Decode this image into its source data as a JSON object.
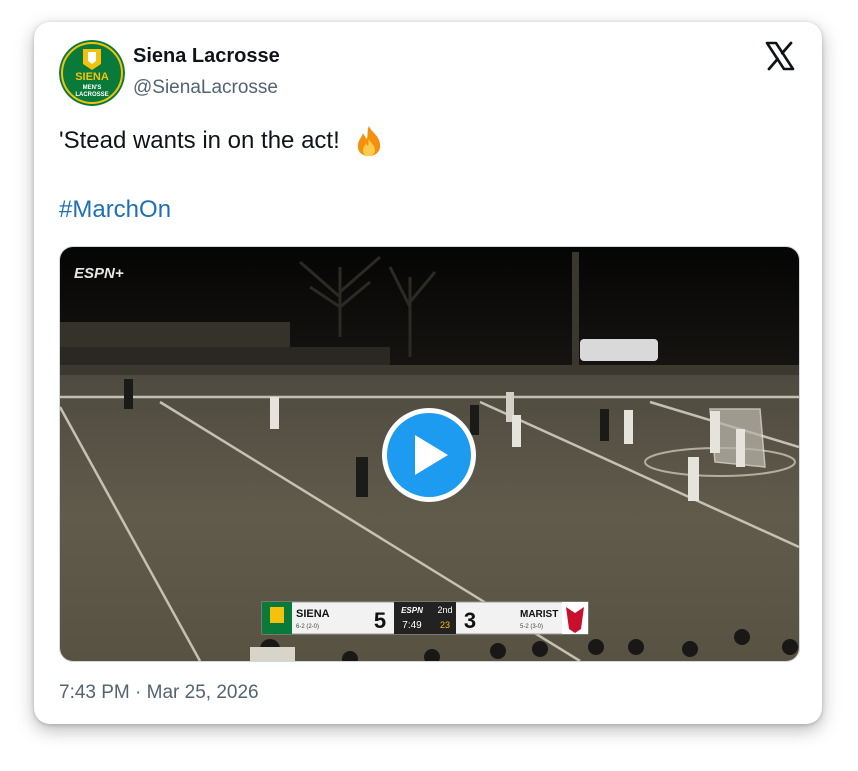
{
  "account": {
    "display_name": "Siena Lacrosse",
    "handle": "@SienaLacrosse",
    "avatar_text_top": "SIENA",
    "avatar_text_mid": "MEN'S",
    "avatar_text_bottom": "LACROSSE"
  },
  "tweet": {
    "text": "'Stead wants in on the act!",
    "emoji": "fire-emoji",
    "hashtag": "#MarchOn",
    "timestamp": "7:43 PM · Mar 25, 2026"
  },
  "video": {
    "broadcaster": "ESPN+",
    "play_icon": "play-icon",
    "scorebug": {
      "home_team": "SIENA",
      "home_record": "6-2 (2-0)",
      "home_score": "5",
      "network": "ESPN",
      "period": "2nd",
      "clock": "7:49",
      "shot_clock": "23",
      "away_team": "MARIST",
      "away_record": "5-2 (3-0)",
      "away_score": "3"
    }
  },
  "colors": {
    "text_primary": "#0f1419",
    "text_secondary": "#536471",
    "link": "#1d6fb8",
    "play_button": "#1d9bf0",
    "siena_green": "#0a7a3a",
    "siena_gold": "#f4c20d",
    "marist_red": "#c8102e"
  }
}
